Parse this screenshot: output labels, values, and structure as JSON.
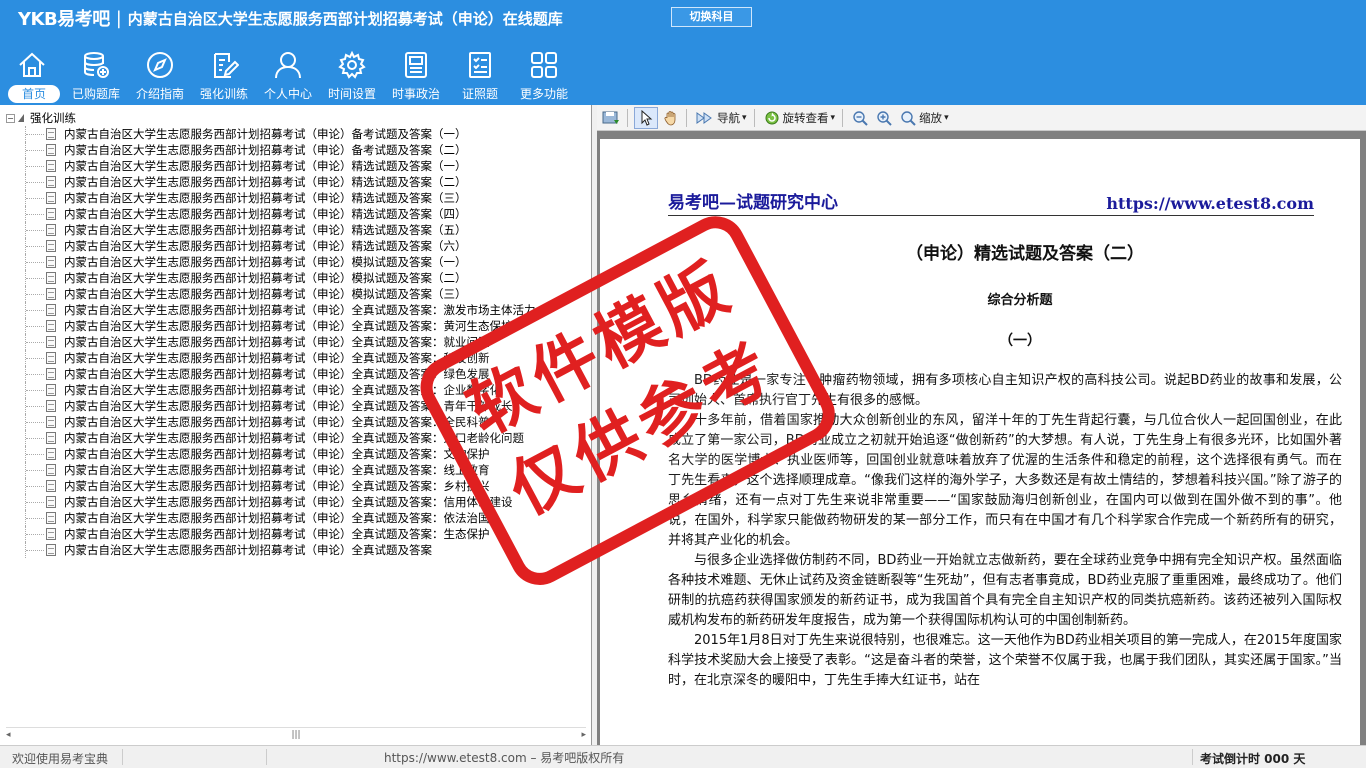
{
  "header": {
    "logo": "YKB易考吧",
    "separator": "|",
    "title": "内蒙古自治区大学生志愿服务西部计划招募考试（申论）在线题库",
    "switch_button": "切换科目"
  },
  "nav": [
    {
      "label": "首页",
      "icon": "home-icon",
      "active": true
    },
    {
      "label": "已购题库",
      "icon": "database-icon"
    },
    {
      "label": "介绍指南",
      "icon": "compass-icon"
    },
    {
      "label": "强化训练",
      "icon": "edit-icon"
    },
    {
      "label": "个人中心",
      "icon": "user-icon"
    },
    {
      "label": "时间设置",
      "icon": "gear-icon"
    },
    {
      "label": "时事政治",
      "icon": "notebook-icon"
    },
    {
      "label": "证照题",
      "icon": "checklist-icon"
    },
    {
      "label": "更多功能",
      "icon": "grid-icon"
    }
  ],
  "tree": {
    "toggle": "−",
    "root": "强化训练",
    "items": [
      "内蒙古自治区大学生志愿服务西部计划招募考试（申论）备考试题及答案（一）",
      "内蒙古自治区大学生志愿服务西部计划招募考试（申论）备考试题及答案（二）",
      "内蒙古自治区大学生志愿服务西部计划招募考试（申论）精选试题及答案（一）",
      "内蒙古自治区大学生志愿服务西部计划招募考试（申论）精选试题及答案（二）",
      "内蒙古自治区大学生志愿服务西部计划招募考试（申论）精选试题及答案（三）",
      "内蒙古自治区大学生志愿服务西部计划招募考试（申论）精选试题及答案（四）",
      "内蒙古自治区大学生志愿服务西部计划招募考试（申论）精选试题及答案（五）",
      "内蒙古自治区大学生志愿服务西部计划招募考试（申论）精选试题及答案（六）",
      "内蒙古自治区大学生志愿服务西部计划招募考试（申论）模拟试题及答案（一）",
      "内蒙古自治区大学生志愿服务西部计划招募考试（申论）模拟试题及答案（二）",
      "内蒙古自治区大学生志愿服务西部计划招募考试（申论）模拟试题及答案（三）",
      "内蒙古自治区大学生志愿服务西部计划招募考试（申论）全真试题及答案：激发市场主体活力",
      "内蒙古自治区大学生志愿服务西部计划招募考试（申论）全真试题及答案：黄河生态保护",
      "内蒙古自治区大学生志愿服务西部计划招募考试（申论）全真试题及答案：就业问题",
      "内蒙古自治区大学生志愿服务西部计划招募考试（申论）全真试题及答案：科技创新",
      "内蒙古自治区大学生志愿服务西部计划招募考试（申论）全真试题及答案：绿色发展",
      "内蒙古自治区大学生志愿服务西部计划招募考试（申论）全真试题及答案：企业数字化",
      "内蒙古自治区大学生志愿服务西部计划招募考试（申论）全真试题及答案：青年干部成长",
      "内蒙古自治区大学生志愿服务西部计划招募考试（申论）全真试题及答案：全民科普",
      "内蒙古自治区大学生志愿服务西部计划招募考试（申论）全真试题及答案：人口老龄化问题",
      "内蒙古自治区大学生志愿服务西部计划招募考试（申论）全真试题及答案：文物保护",
      "内蒙古自治区大学生志愿服务西部计划招募考试（申论）全真试题及答案：线上教育",
      "内蒙古自治区大学生志愿服务西部计划招募考试（申论）全真试题及答案：乡村振兴",
      "内蒙古自治区大学生志愿服务西部计划招募考试（申论）全真试题及答案：信用体系建设",
      "内蒙古自治区大学生志愿服务西部计划招募考试（申论）全真试题及答案：依法治国",
      "内蒙古自治区大学生志愿服务西部计划招募考试（申论）全真试题及答案：生态保护",
      "内蒙古自治区大学生志愿服务西部计划招募考试（申论）全真试题及答案"
    ],
    "scroll_left": "◂",
    "scroll_thumb": "|||",
    "scroll_right": "▸"
  },
  "toolbar": {
    "navigate": "导航",
    "rotate": "旋转查看",
    "zoom": "缩放",
    "dropdown": "▾"
  },
  "document": {
    "header_left": "易考吧—试题研究中心",
    "header_right": "https://www.etest8.com",
    "title": "（申论）精选试题及答案（二）",
    "subtitle": "综合分析题",
    "section": "（一）",
    "paragraphs": [
      "BD药业是一家专注于肿瘤药物领域，拥有多项核心自主知识产权的高科技公司。说起BD药业的故事和发展，公司创始人、首席执行官丁先生有很多的感慨。",
      "十多年前，借着国家推动大众创新创业的东风，留洋十年的丁先生背起行囊，与几位合伙人一起回国创业，在此成立了第一家公司，BD药业成立之初就开始追逐“做创新药”的大梦想。有人说，丁先生身上有很多光环，比如国外著名大学的医学博士、执业医师等，回国创业就意味着放弃了优渥的生活条件和稳定的前程，这个选择很有勇气。而在丁先生看来，这个选择顺理成章。“像我们这样的海外学子，大多数还是有故土情结的，梦想着科技兴国。”除了游子的思乡情绪，还有一点对丁先生来说非常重要——“国家鼓励海归创新创业，在国内可以做到在国外做不到的事”。他说，在国外，科学家只能做药物研发的某一部分工作，而只有在中国才有几个科学家合作完成一个新药所有的研究，并将其产业化的机会。",
      "与很多企业选择做仿制药不同，BD药业一开始就立志做新药，要在全球药业竞争中拥有完全知识产权。虽然面临各种技术难题、无休止试药及资金链断裂等“生死劫”，但有志者事竟成，BD药业克服了重重困难，最终成功了。他们研制的抗癌药获得国家颁发的新药证书，成为我国首个具有完全自主知识产权的同类抗癌新药。该药还被列入国际权威机构发布的新药研发年度报告，成为第一个获得国际机构认可的中国创制新药。",
      "2015年1月8日对丁先生来说很特别，也很难忘。这一天他作为BD药业相关项目的第一完成人，在2015年度国家科学技术奖励大会上接受了表彰。“这是奋斗者的荣誉，这个荣誉不仅属于我，也属于我们团队，其实还属于国家。”当时，在北京深冬的暖阳中，丁先生手捧大红证书，站在"
    ]
  },
  "stamp": {
    "line1": "软件模版",
    "line2": "仅供参考"
  },
  "status": {
    "left": "欢迎使用易考宝典",
    "center": "https://www.etest8.com – 易考吧版权所有",
    "right": "考试倒计时 000 天"
  },
  "colors": {
    "header_bg": "#2c8ee0",
    "stamp_red": "#e02020",
    "doc_header_blue": "#1b1b9b"
  }
}
